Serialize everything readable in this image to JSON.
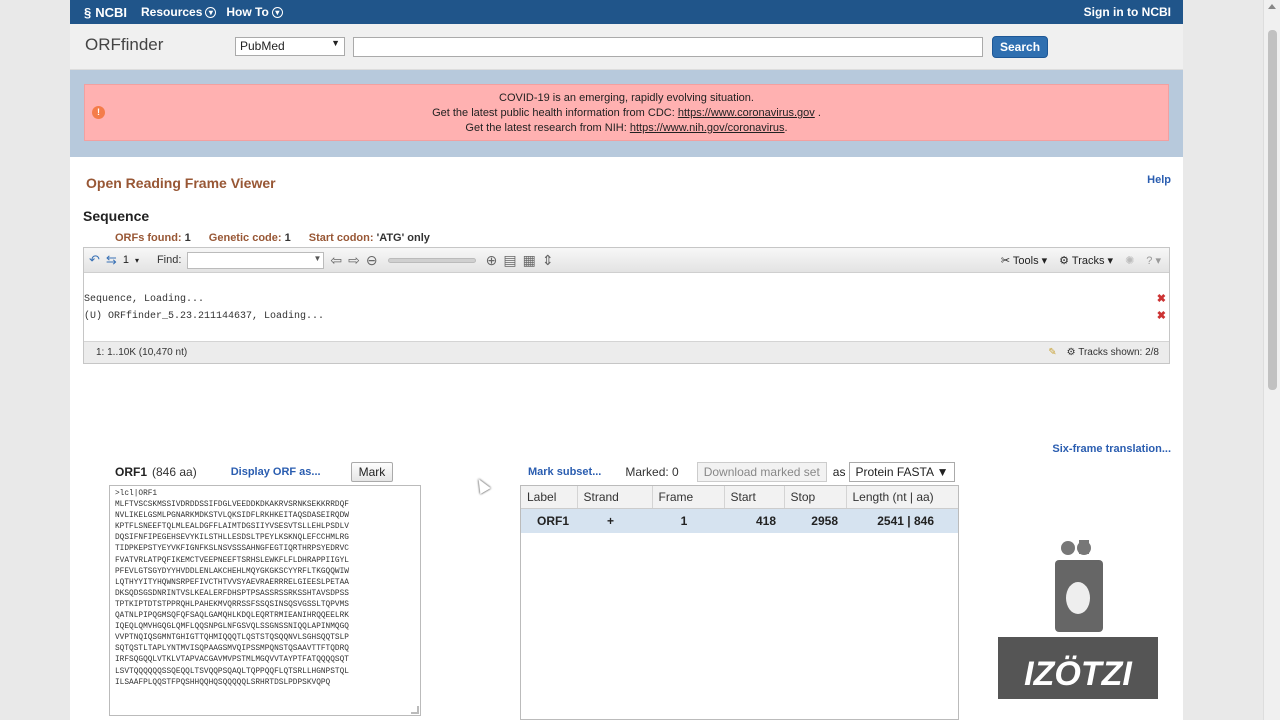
{
  "ncbi": {
    "logo_text": "NCBI",
    "menus": [
      "Resources",
      "How To"
    ],
    "signin": "Sign in to NCBI"
  },
  "search": {
    "app_title": "ORFfinder",
    "db": "PubMed",
    "button": "Search"
  },
  "covid": {
    "line1": "COVID-19 is an emerging, rapidly evolving situation.",
    "line2_pre": "Get the latest public health information from CDC: ",
    "line2_link": "https://www.coronavirus.gov",
    "line2_post": " .",
    "line3_pre": "Get the latest research from NIH: ",
    "line3_link": "https://www.nih.gov/coronavirus",
    "line3_post": "."
  },
  "viewer": {
    "title": "Open Reading Frame Viewer",
    "help": "Help",
    "sequence_title": "Sequence",
    "stats": [
      {
        "label": "ORFs found:",
        "value": "1"
      },
      {
        "label": "Genetic code:",
        "value": "1"
      },
      {
        "label": "Start codon:",
        "value": "'ATG' only"
      }
    ],
    "toolbar": {
      "frame_count": "1",
      "find_label": "Find:",
      "tools": "Tools",
      "tracks": "Tracks"
    },
    "tracks": [
      "Sequence, Loading...",
      "(U) ORFfinder_5.23.211144637, Loading..."
    ],
    "status_left": "1: 1..10K (10,470 nt)",
    "status_right": "Tracks shown: 2/8"
  },
  "six_frame": "Six-frame translation...",
  "orf": {
    "name": "ORF1",
    "length": "(846 aa)",
    "display_link": "Display ORF as...",
    "mark_button": "Mark",
    "sequence": ">lcl|ORF1\nMLFTVSCSKMSSIVDRDDSSIFDGLVEEDDKDKAKRVSRNKSEKKRRDQF\nNVLIKELGSMLPGNARKMDKSTVLQKSIDFLRKHKEITAQSDASEIRQDW\nKPTFLSNEEFTQLMLEALDGFFLAIMTDGSIIYVSESVTSLLEHLPSDLV\nDQSIFNFIPEGEHSEVYKILSTHLLESDSLTPEYLKSKNQLEFCCHMLRG\nTIDPKEPSTYEYVKFIGNFKSLNSVSSSAHNGFEGTIQRTHRPSYEDRVC\nFVATVRLATPQFIKEMCTVEEPNEEFTSRHSLEWKFLFLDHRAPPIIGYL\nPFEVLGTSGYDYYHVDDLENLAKCHEHLMQYGKGKSCYYRFLTKGQQWIW\nLQTHYYITYHQWNSRPEFIVCTHTVVSYAEVRAERRRELGIEESLPETAA\nDKSQDSGSDNRINTVSLKEALERFDHSPTPSASSRSSRKSSHTAVSDPSS\nTPTKIPTDTSTPPRQHLPAHEKMVQRRSSFSSQSINSQSVGSSLTQPVMS\nQATNLPIPQGMSQFQFSAQLGAMQHLKDQLEQRTRMIEANIHRQQEELRK\nIQEQLQMVHGQGLQMFLQQSNPGLNFGSVQLSSGNSSNIQQLAPINMQGQ\nVVPTNQIQSGMNTGHIGTTQHMIQQQTLQSTSTQSQQNVLSGHSQQTSLP\nSQTQSTLTAPLYNTMVISQPAAGSMVQIPSSMPQNSTQSAAVTTFTQDRQ\nIRFSQGQQLVTKLVTAPVACGAVMVPSTMLMGQVVTAYPTFATQQQQSQT\nLSVTQQQQQQSSQEQQLTSVQQPSQAQLTQPPQQFLQTSRLLHGNPSTQL\nILSAAFPLQQSTFPQSHHQQHQSQQQQQLSRHRTDSLPDPSKVQPQ"
  },
  "table": {
    "mark_subset": "Mark subset...",
    "marked": "Marked: 0",
    "download": "Download marked set",
    "as": "as",
    "format": "Protein FASTA",
    "columns": [
      "Label",
      "Strand",
      "Frame",
      "Start",
      "Stop",
      "Length (nt | aa)"
    ],
    "rows": [
      {
        "label": "ORF1",
        "strand": "+",
        "frame": "1",
        "start": "418",
        "stop": "2958",
        "length": "2541 | 846"
      }
    ]
  },
  "watermark": {
    "text": "IZÖTZI"
  },
  "colors": {
    "ncbi_blue": "#20558a",
    "accent_brown": "#985735",
    "link_blue": "#2a5db0",
    "covid_pink": "#ffb1b1"
  }
}
